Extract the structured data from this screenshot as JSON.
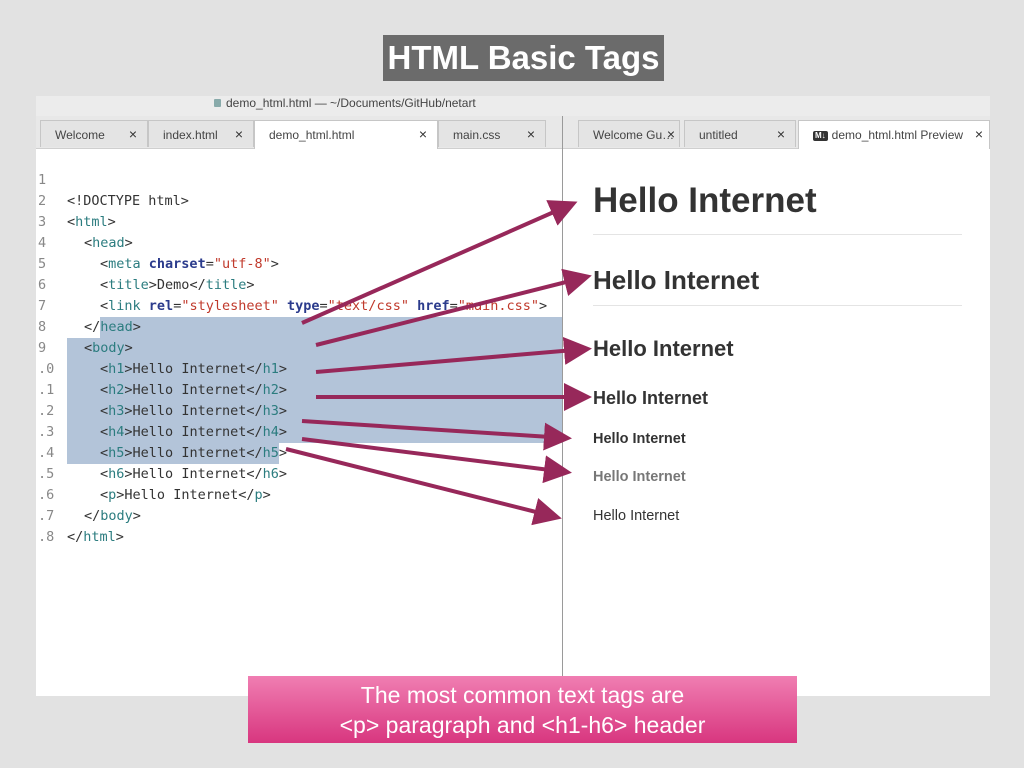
{
  "slide": {
    "title": "HTML Basic Tags",
    "caption_line1": "The most common text tags are",
    "caption_line2": "<p> paragraph and <h1-h6> header"
  },
  "window": {
    "title": "demo_html.html — ~/Documents/GitHub/netart"
  },
  "left_tabs": [
    {
      "label": "Welcome",
      "close": "×"
    },
    {
      "label": "index.html",
      "close": "×"
    },
    {
      "label": "demo_html.html",
      "close": "×"
    },
    {
      "label": "main.css",
      "close": "×"
    }
  ],
  "right_tabs": [
    {
      "label": "Welcome Gu…",
      "close": "×"
    },
    {
      "label": "untitled",
      "close": "×"
    },
    {
      "label": "demo_html.html Preview",
      "close": "×",
      "icon_text": "M↓"
    }
  ],
  "editor": {
    "line_numbers": [
      "1",
      "2",
      "3",
      "4",
      "5",
      "6",
      "7",
      "8",
      "9",
      ".0",
      ".1",
      ".2",
      ".3",
      ".4",
      ".5",
      ".6",
      ".7",
      ".8"
    ],
    "tokens": {
      "doctype": "<!DOCTYPE html>",
      "lt": "<",
      "lt_close": "</",
      "gt": ">",
      "eq": "=",
      "sp": " ",
      "html": "html",
      "head": "head",
      "meta": "meta",
      "charset": "charset",
      "charset_val": "\"utf-8\"",
      "title": "title",
      "title_text": "Demo",
      "link": "link",
      "rel": "rel",
      "rel_val": "\"stylesheet\"",
      "type": "type",
      "type_val": "\"text/css\"",
      "href": "href",
      "href_val": "\"main.css\"",
      "body": "body",
      "h1": "h1",
      "h2": "h2",
      "h3": "h3",
      "h4": "h4",
      "h5": "h5",
      "h6": "h6",
      "p": "p",
      "content": "Hello Internet"
    }
  },
  "preview": {
    "h1": "Hello Internet",
    "h2": "Hello Internet",
    "h3": "Hello Internet",
    "h4": "Hello Internet",
    "h5": "Hello Internet",
    "h6": "Hello Internet",
    "p": "Hello Internet"
  },
  "colors": {
    "arrow": "#97285a",
    "selection": "#b3c4d9",
    "tag": "#2b7c7f",
    "attribute": "#2b3b8c",
    "string": "#c0392b"
  }
}
